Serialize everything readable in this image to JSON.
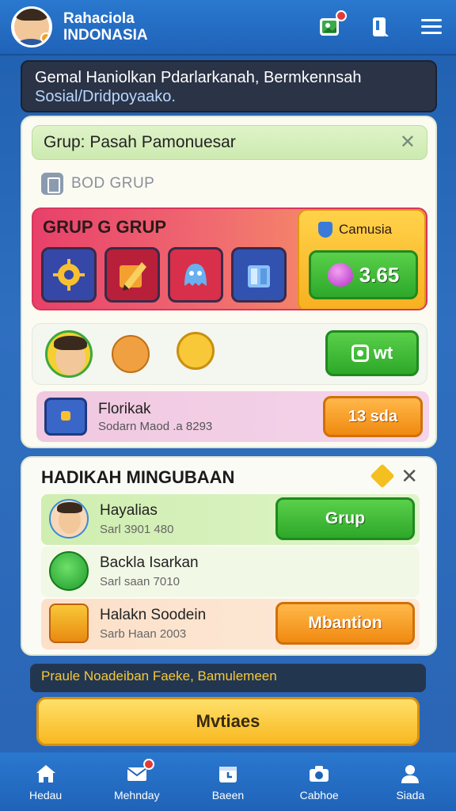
{
  "header": {
    "title_line1": "Rahaciola",
    "title_line2": "INDONASIA"
  },
  "announcement": {
    "line1": "Gemal Haniolkan Pdarlarkanah, Bermkennsah",
    "line2": "Sosial/Dridpoyaako."
  },
  "card": {
    "group_bar": "Grup: Pasah Pamonuesar",
    "sub_label": "BOD GRUP",
    "panel_title": "GRUP G GRUP",
    "right_label": "Camusia",
    "value": "3.65",
    "green_btn": "wt",
    "promo_title": "Florikak",
    "promo_sub": "Sodarn Maod .a 8293",
    "promo_btn": "13 sda"
  },
  "card2": {
    "title": "HADIKAH MINGUBAAN",
    "rows": [
      {
        "title": "Hayalias",
        "sub": "Sarl 3901 480",
        "btn": "Grup"
      },
      {
        "title": "Backla Isarkan",
        "sub": "Sarl saan 7010",
        "btn": ""
      },
      {
        "title": "Halakn Soodein",
        "sub": "Sarb Haan 2003",
        "btn": "Mbantion"
      }
    ]
  },
  "notice": "Praule Noadeiban Faeke, Bamulemeen",
  "big_button": "Mvtiaes",
  "nav": [
    {
      "label": "Hedau",
      "icon": "home-icon"
    },
    {
      "label": "Mehnday",
      "icon": "mail-icon"
    },
    {
      "label": "Baeen",
      "icon": "calendar-icon"
    },
    {
      "label": "Cabhoe",
      "icon": "camera-icon"
    },
    {
      "label": "Siada",
      "icon": "profile-icon"
    }
  ],
  "colors": {
    "primary_blue": "#1f63b8",
    "green": "#2ea82a",
    "orange": "#f08a10",
    "yellow": "#f8b820"
  }
}
